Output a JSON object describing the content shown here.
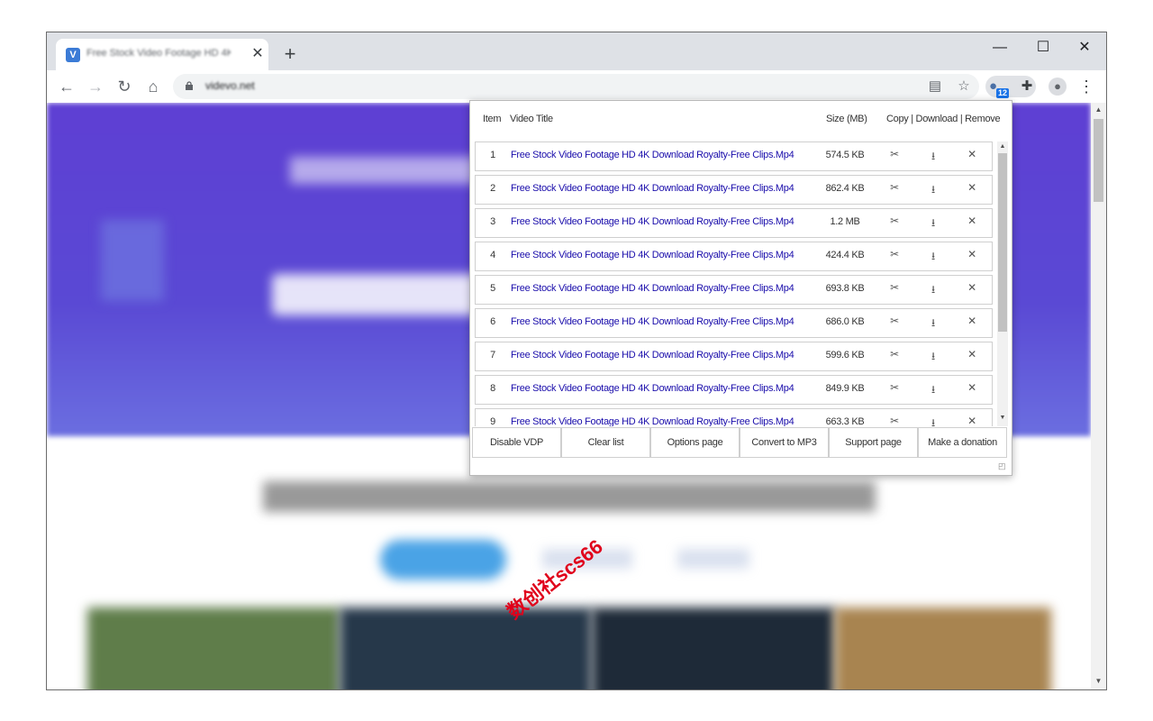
{
  "browser": {
    "tab_title": "Free Stock Video Footage HD 4K",
    "tab_favicon_letter": "V",
    "url": "videvo.net",
    "extension_badge": "12"
  },
  "popup": {
    "headers": {
      "item": "Item",
      "title": "Video Title",
      "size": "Size (MB)",
      "actions": "Copy | Download | Remove"
    },
    "rows": [
      {
        "num": "1",
        "title": "Free Stock Video Footage HD 4K Download Royalty-Free Clips.Mp4",
        "size": "574.5 KB"
      },
      {
        "num": "2",
        "title": "Free Stock Video Footage HD 4K Download Royalty-Free Clips.Mp4",
        "size": "862.4 KB"
      },
      {
        "num": "3",
        "title": "Free Stock Video Footage HD 4K Download Royalty-Free Clips.Mp4",
        "size": "1.2 MB"
      },
      {
        "num": "4",
        "title": "Free Stock Video Footage HD 4K Download Royalty-Free Clips.Mp4",
        "size": "424.4 KB"
      },
      {
        "num": "5",
        "title": "Free Stock Video Footage HD 4K Download Royalty-Free Clips.Mp4",
        "size": "693.8 KB"
      },
      {
        "num": "6",
        "title": "Free Stock Video Footage HD 4K Download Royalty-Free Clips.Mp4",
        "size": "686.0 KB"
      },
      {
        "num": "7",
        "title": "Free Stock Video Footage HD 4K Download Royalty-Free Clips.Mp4",
        "size": "599.6 KB"
      },
      {
        "num": "8",
        "title": "Free Stock Video Footage HD 4K Download Royalty-Free Clips.Mp4",
        "size": "849.9 KB"
      },
      {
        "num": "9",
        "title": "Free Stock Video Footage HD 4K Download Royalty-Free Clips.Mp4",
        "size": "663.3 KB"
      }
    ],
    "buttons": [
      "Disable VDP",
      "Clear list",
      "Options page",
      "Convert to MP3",
      "Support page",
      "Make a donation"
    ]
  },
  "icons": {
    "copy": "✂",
    "download": "⭳",
    "remove": "✕"
  },
  "watermark": "数创社scs66"
}
